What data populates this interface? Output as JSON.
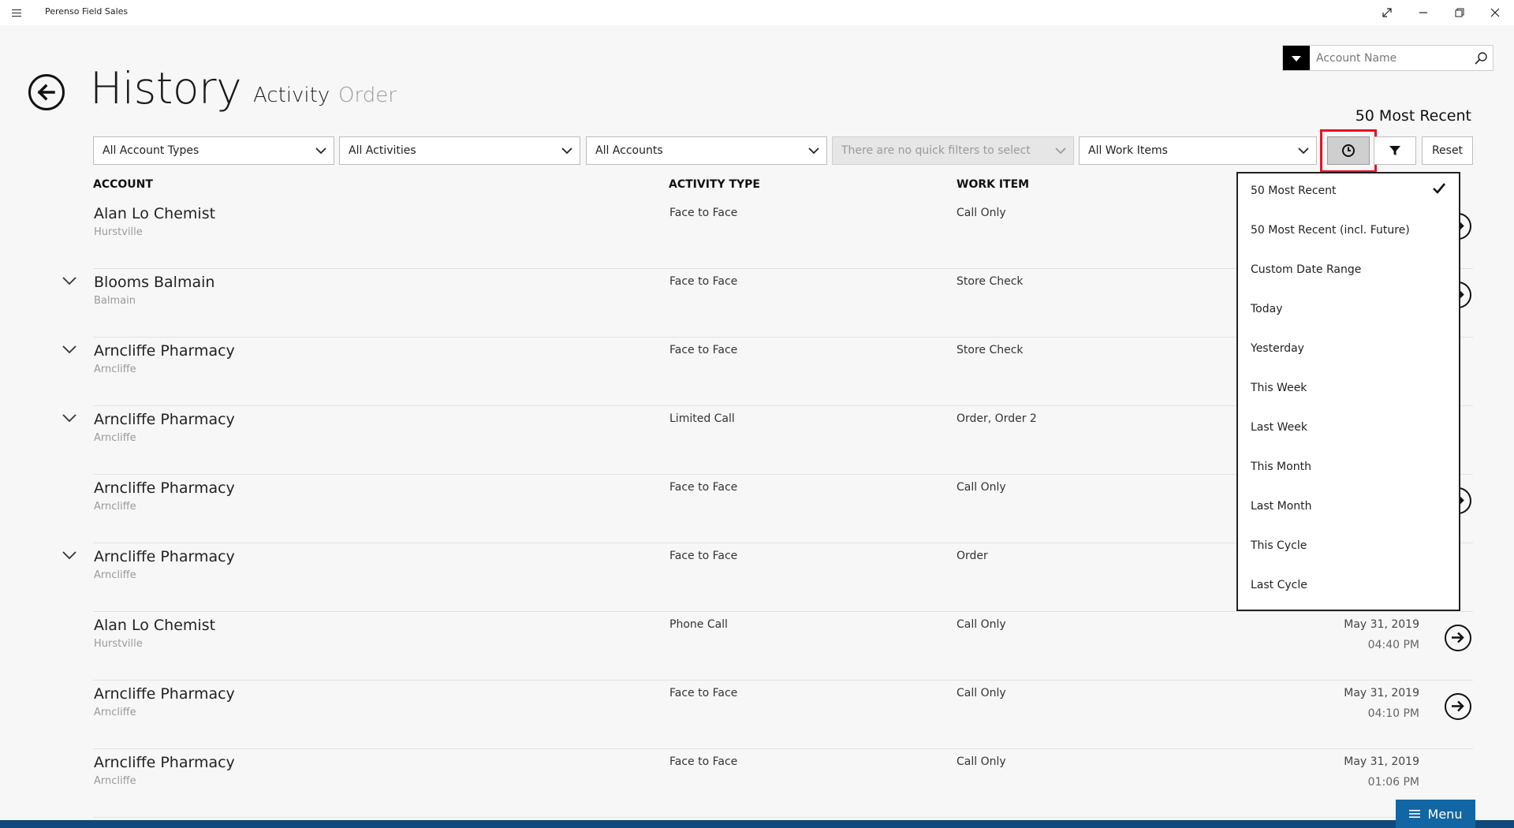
{
  "app": {
    "title": "Perenso Field Sales"
  },
  "header": {
    "page_title": "History",
    "tabs": [
      {
        "label": "Activity",
        "active": true
      },
      {
        "label": "Order",
        "active": false
      }
    ],
    "search_placeholder": "Account Name",
    "recent_label": "50 Most Recent"
  },
  "filters": {
    "account_types": "All Account Types",
    "activities": "All Activities",
    "accounts": "All Accounts",
    "quick_filters": "There are no quick filters to select",
    "work_items": "All Work Items",
    "reset_label": "Reset"
  },
  "columns": {
    "account": "ACCOUNT",
    "activity_type": "ACTIVITY TYPE",
    "work_item": "WORK ITEM"
  },
  "rows": [
    {
      "name": "Alan Lo Chemist",
      "location": "Hurstville",
      "activity_type": "Face to Face",
      "work_item": "Call Only",
      "date": "",
      "time": "",
      "expandable": false
    },
    {
      "name": "Blooms Balmain",
      "location": "Balmain",
      "activity_type": "Face to Face",
      "work_item": "Store Check",
      "date": "",
      "time": "",
      "expandable": true
    },
    {
      "name": "Arncliffe Pharmacy",
      "location": "Arncliffe",
      "activity_type": "Face to Face",
      "work_item": "Store Check",
      "date": "",
      "time": "",
      "expandable": true
    },
    {
      "name": "Arncliffe Pharmacy",
      "location": "Arncliffe",
      "activity_type": "Limited Call",
      "work_item": "Order, Order 2",
      "date": "",
      "time": "",
      "expandable": true
    },
    {
      "name": "Arncliffe Pharmacy",
      "location": "Arncliffe",
      "activity_type": "Face to Face",
      "work_item": "Call Only",
      "date": "",
      "time": "",
      "expandable": false
    },
    {
      "name": "Arncliffe Pharmacy",
      "location": "Arncliffe",
      "activity_type": "Face to Face",
      "work_item": "Order",
      "date": "",
      "time": "",
      "expandable": true
    },
    {
      "name": "Alan Lo Chemist",
      "location": "Hurstville",
      "activity_type": "Phone Call",
      "work_item": "Call Only",
      "date": "May 31, 2019",
      "time": "04:40 PM",
      "expandable": false
    },
    {
      "name": "Arncliffe Pharmacy",
      "location": "Arncliffe",
      "activity_type": "Face to Face",
      "work_item": "Call Only",
      "date": "May 31, 2019",
      "time": "04:10 PM",
      "expandable": false
    },
    {
      "name": "Arncliffe Pharmacy",
      "location": "Arncliffe",
      "activity_type": "Face to Face",
      "work_item": "Call Only",
      "date": "May 31, 2019",
      "time": "01:06 PM",
      "expandable": false
    }
  ],
  "date_menu": {
    "selected": "50 Most Recent",
    "items": [
      "50 Most Recent",
      "50 Most Recent (incl. Future)",
      "Custom Date Range",
      "Today",
      "Yesterday",
      "This Week",
      "Last Week",
      "This Month",
      "Last Month",
      "This Cycle",
      "Last Cycle"
    ]
  },
  "bottom": {
    "menu_label": "Menu"
  }
}
